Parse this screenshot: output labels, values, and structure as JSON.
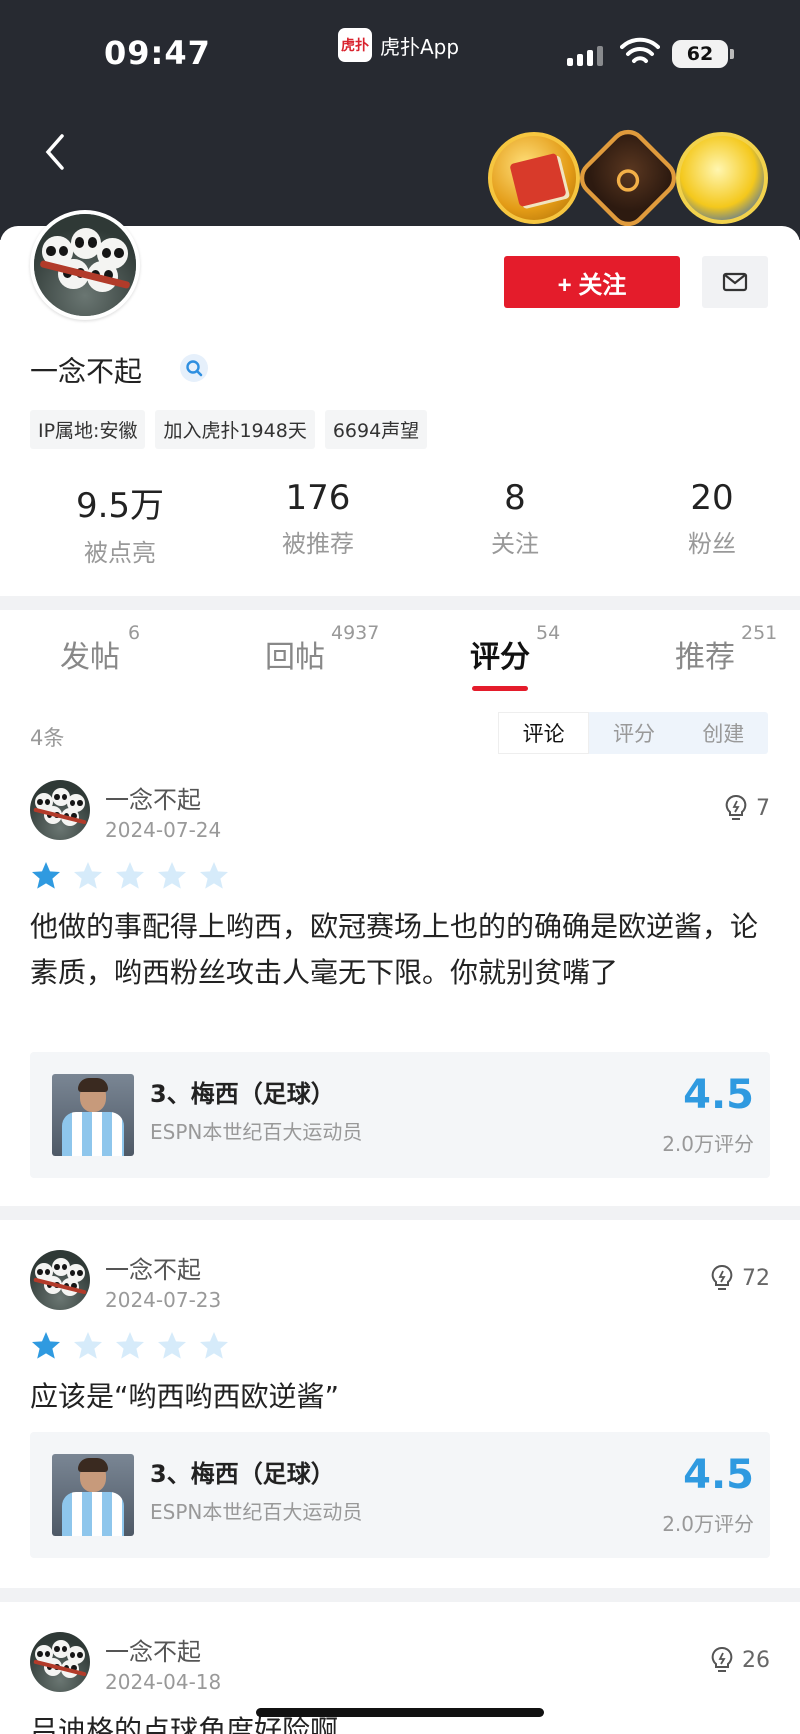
{
  "status_bar": {
    "time": "09:47",
    "app_name": "虎扑App",
    "app_logo_text": "虎扑",
    "battery": "62"
  },
  "profile": {
    "username": "一念不起",
    "follow_label": "+ 关注",
    "tags": [
      "IP属地:安徽",
      "加入虎扑1948天",
      "6694声望"
    ],
    "stats": [
      {
        "value": "9.5万",
        "label": "被点亮"
      },
      {
        "value": "176",
        "label": "被推荐"
      },
      {
        "value": "8",
        "label": "关注"
      },
      {
        "value": "20",
        "label": "粉丝"
      }
    ]
  },
  "tabs": [
    {
      "label": "发帖",
      "count": "6"
    },
    {
      "label": "回帖",
      "count": "4937"
    },
    {
      "label": "评分",
      "count": "54",
      "active": true
    },
    {
      "label": "推荐",
      "count": "251"
    }
  ],
  "list": {
    "count_text": "4条",
    "segments": [
      "评论",
      "评分",
      "创建"
    ],
    "selected_segment": "评论"
  },
  "reviews": [
    {
      "name": "一念不起",
      "date": "2024-07-24",
      "likes": "7",
      "stars": 1,
      "text": "他做的事配得上哟西，欧冠赛场上也的的确确是欧逆酱，论素质，哟西粉丝攻击人毫无下限。你就别贫嘴了",
      "item": {
        "title": "3、梅西（足球）",
        "subtitle": "ESPN本世纪百大运动员",
        "score": "4.5",
        "votes": "2.0万评分"
      }
    },
    {
      "name": "一念不起",
      "date": "2024-07-23",
      "likes": "72",
      "stars": 1,
      "text": "应该是“哟西哟西欧逆酱”",
      "item": {
        "title": "3、梅西（足球）",
        "subtitle": "ESPN本世纪百大运动员",
        "score": "4.5",
        "votes": "2.0万评分"
      }
    },
    {
      "name": "一念不起",
      "date": "2024-04-18",
      "likes": "26",
      "text": "吕迪格的点球角度好险啊"
    }
  ],
  "colors": {
    "accent_red": "#e41c2b",
    "score_blue": "#2f9ae0",
    "header_dark": "#272a31"
  }
}
